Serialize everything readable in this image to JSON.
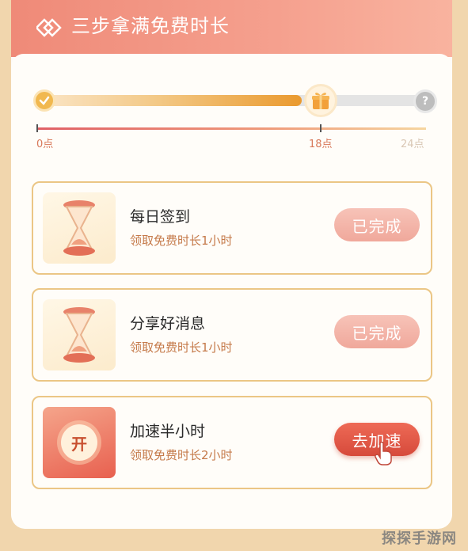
{
  "header": {
    "title": "三步拿满免费时长",
    "logo_icon": "diamond-logo-icon"
  },
  "progress": {
    "filled_fraction": 0.69,
    "labels": {
      "start": "0点",
      "mid": "18点",
      "end": "24点"
    },
    "end_icon_text": "?"
  },
  "tasks": [
    {
      "name": "每日签到",
      "desc": "领取免费时长1小时",
      "button": "已完成",
      "status": "done",
      "icon": "hourglass-icon"
    },
    {
      "name": "分享好消息",
      "desc": "领取免费时长1小时",
      "button": "已完成",
      "status": "done",
      "icon": "hourglass-icon"
    },
    {
      "name": "加速半小时",
      "desc": "领取免费时长2小时",
      "button": "去加速",
      "status": "todo",
      "icon": "power-on-icon",
      "icon_text": "开"
    }
  ],
  "watermark": "探探手游网",
  "colors": {
    "header": "#ef8a78",
    "border": "#ebc685",
    "accent": "#d64a3b"
  }
}
